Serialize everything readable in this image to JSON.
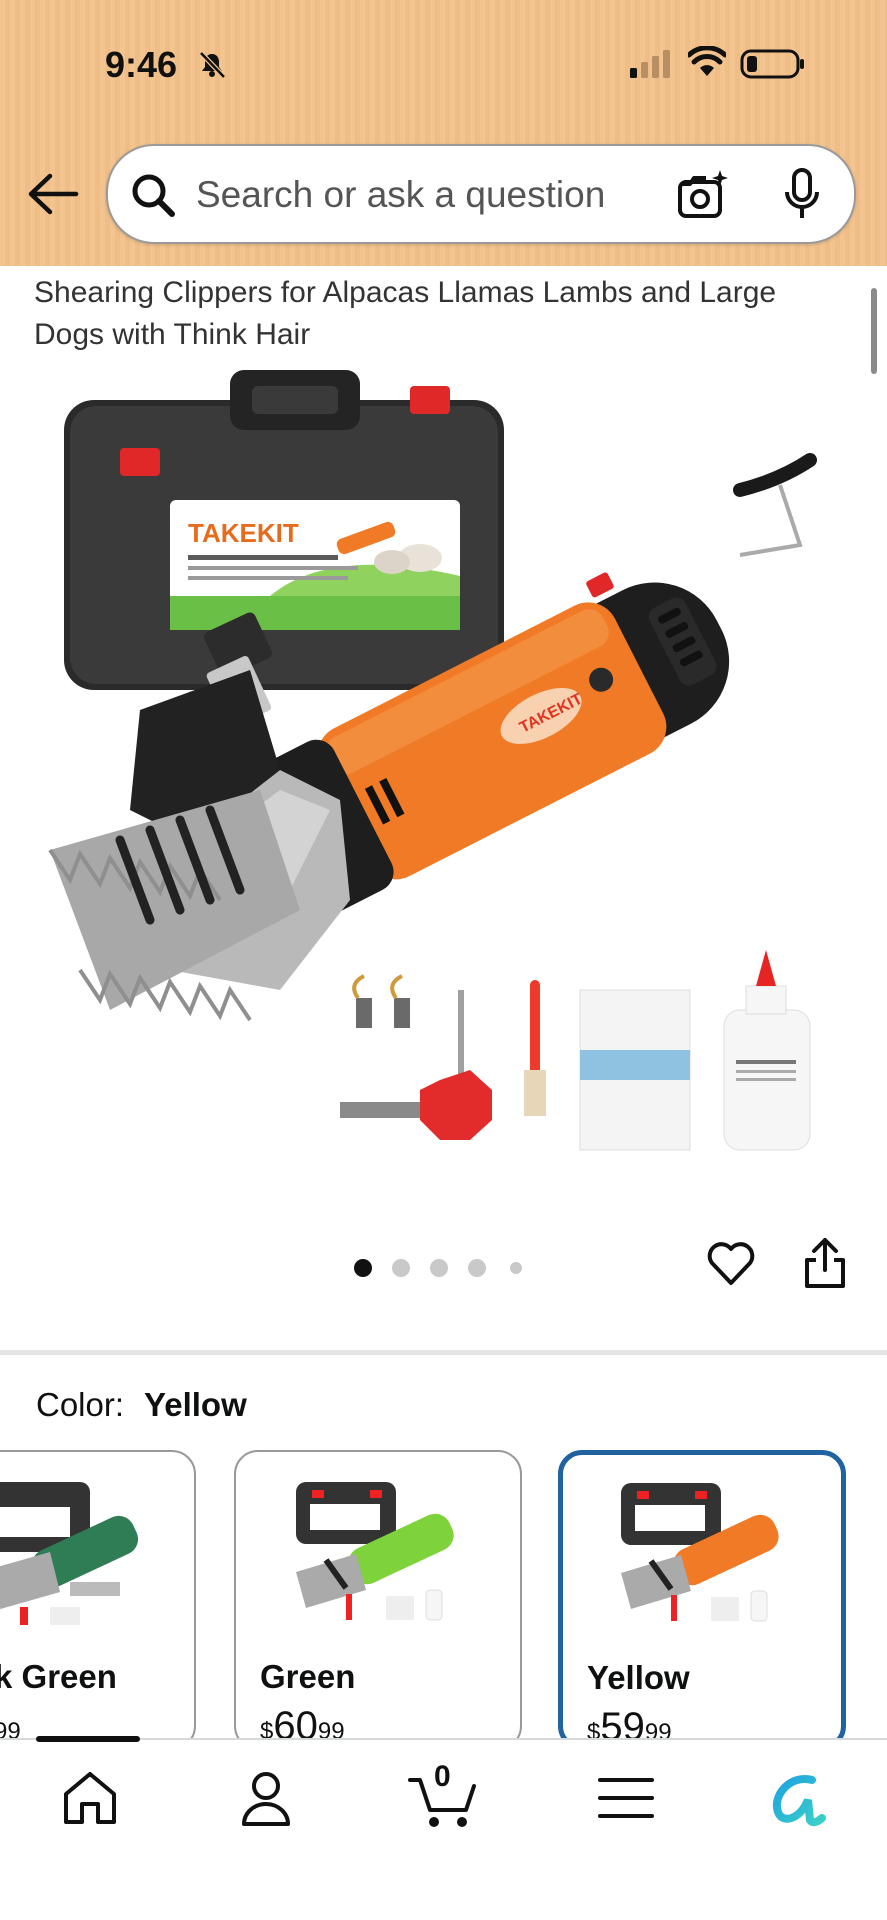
{
  "status_bar": {
    "time": "9:46"
  },
  "search": {
    "placeholder": "Search or ask a question"
  },
  "product": {
    "title": "Shearing Clippers for Alpacas Llamas Lambs and Large Dogs with Think Hair",
    "brand_print": "TAKEKIT"
  },
  "carousel": {
    "page_count": 5,
    "current": 1
  },
  "color_selector": {
    "label": "Color:",
    "selected": "Yellow",
    "options": [
      {
        "name": "k Green",
        "price_main": "",
        "price_cents": "99",
        "accent": "#2f7d55"
      },
      {
        "name": "Green",
        "price_main": "60",
        "price_cents": "99",
        "accent": "#7ed23c"
      },
      {
        "name": "Yellow",
        "price_main": "59",
        "price_cents": "99",
        "accent": "#f07a25",
        "selected": true
      }
    ]
  },
  "bottom_nav": {
    "items": [
      "home-icon",
      "account-icon",
      "cart-icon",
      "menu-icon",
      "rufus-icon"
    ],
    "cart_count": "0"
  },
  "colors": {
    "header_bg": "#f3c48f",
    "selected_border": "#2162a1",
    "product_orange": "#f07a25"
  }
}
